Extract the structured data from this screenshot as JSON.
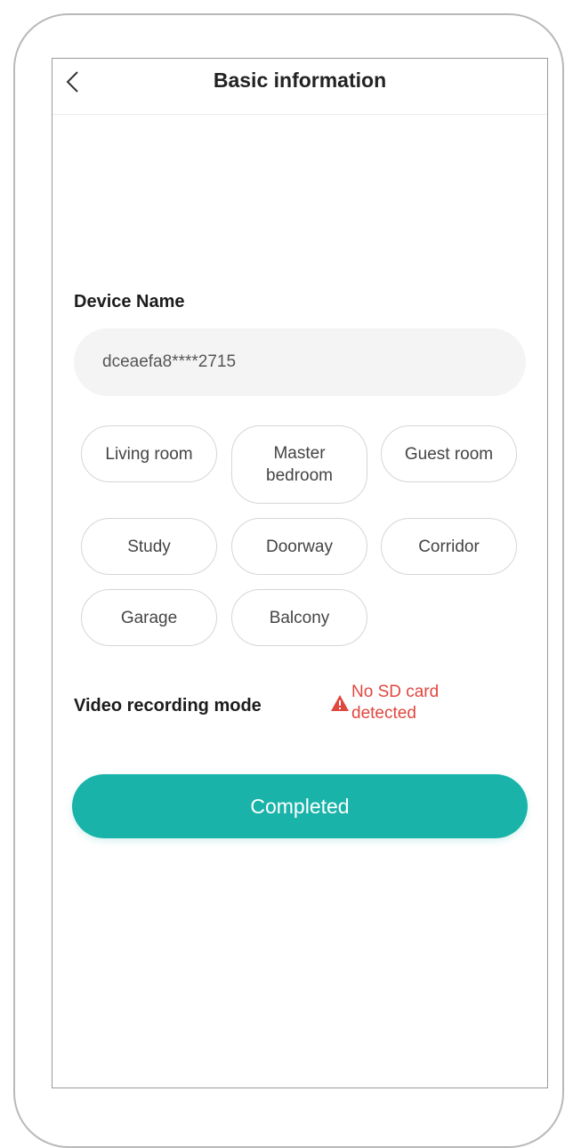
{
  "header": {
    "title": "Basic information",
    "back_icon": "chevron-left-icon"
  },
  "device": {
    "label": "Device Name",
    "value": "dceaefa8****2715",
    "placeholder": ""
  },
  "rooms": [
    {
      "label": "Living room"
    },
    {
      "label": "Master bedroom"
    },
    {
      "label": "Guest room"
    },
    {
      "label": "Study"
    },
    {
      "label": "Doorway"
    },
    {
      "label": "Corridor"
    },
    {
      "label": "Garage"
    },
    {
      "label": "Balcony"
    }
  ],
  "recording": {
    "label": "Video recording mode",
    "warning": "No SD card detected",
    "warning_icon": "warning-triangle-icon",
    "warning_color": "#e0473f"
  },
  "actions": {
    "completed_label": "Completed",
    "accent_color": "#19b3a9"
  }
}
